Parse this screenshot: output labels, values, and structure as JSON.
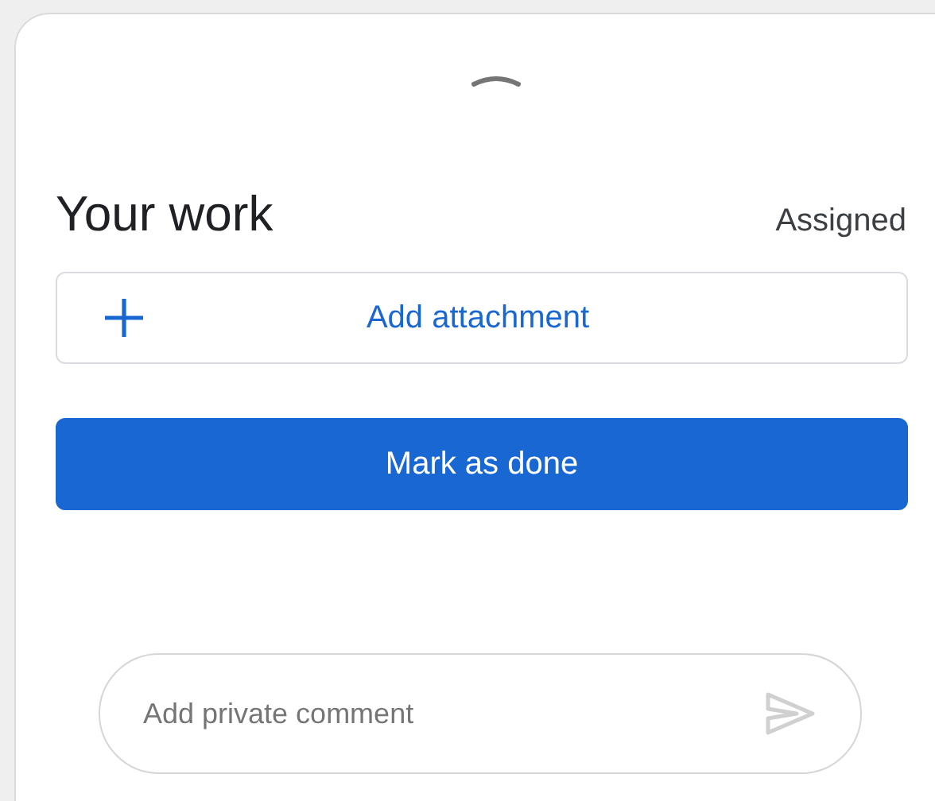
{
  "handle": {
    "expanded": false
  },
  "heading": {
    "title": "Your work",
    "status": "Assigned"
  },
  "attachment_button": {
    "label": "Add attachment"
  },
  "done_button": {
    "label": "Mark as done"
  },
  "comment": {
    "placeholder": "Add private comment",
    "send_disabled": true
  }
}
